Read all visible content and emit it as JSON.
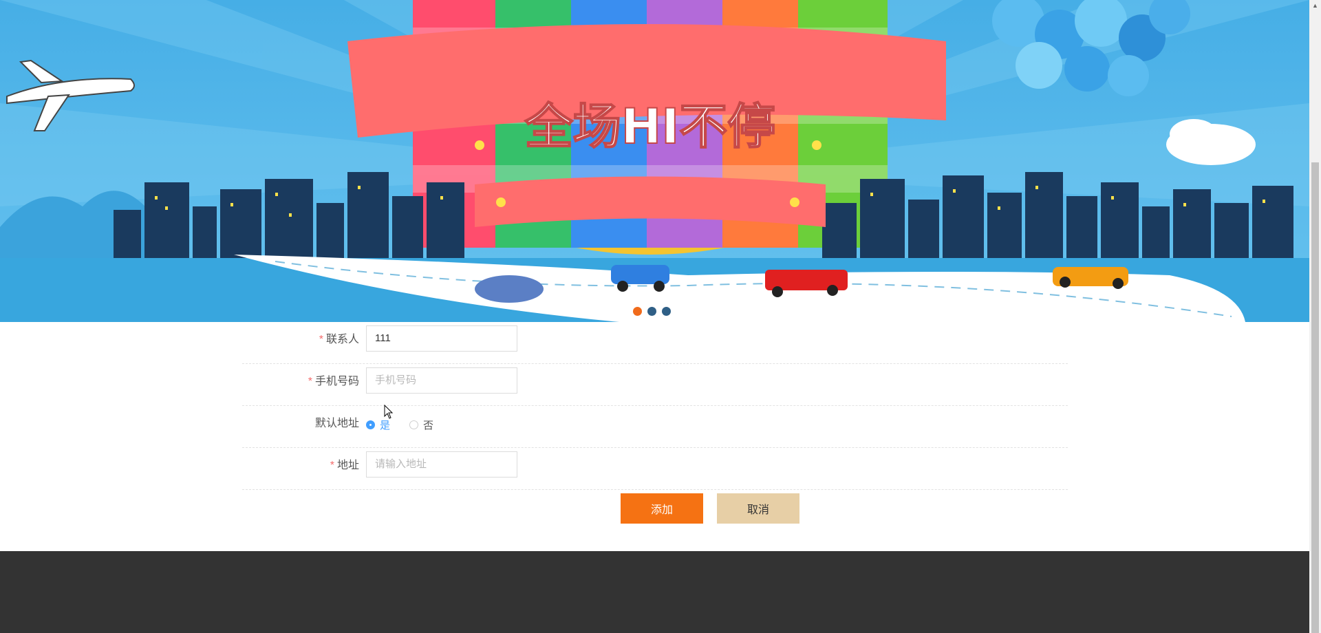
{
  "banner": {
    "headline": "全场HI不停",
    "slides": [
      "slide-1",
      "slide-2",
      "slide-3"
    ],
    "active_slide": 0,
    "colors": {
      "sky": "#4fb2e6",
      "ribbon": "#ff6d6d",
      "city": "#1a3a5e",
      "road": "#ffffff"
    }
  },
  "form": {
    "contact": {
      "label": "联系人",
      "required": "*",
      "value": "111"
    },
    "phone": {
      "label": "手机号码",
      "required": "*",
      "placeholder": "手机号码"
    },
    "default_address": {
      "label": "默认地址",
      "options": [
        {
          "label": "是",
          "checked": true
        },
        {
          "label": "否",
          "checked": false
        }
      ]
    },
    "address": {
      "label": "地址",
      "required": "*",
      "placeholder": "请输入地址"
    }
  },
  "actions": {
    "add": "添加",
    "cancel": "取消"
  },
  "colors": {
    "add_button": "#f57213",
    "cancel_button": "#e7cfa6",
    "footer": "#333333",
    "radio_active": "#409eff"
  }
}
